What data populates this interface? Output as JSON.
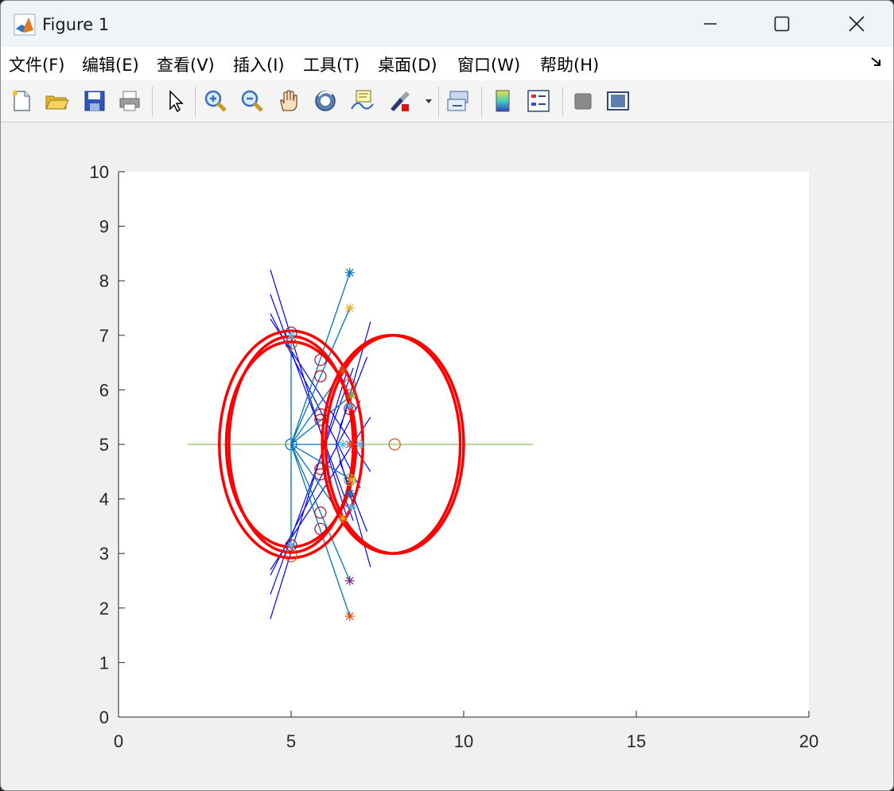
{
  "window": {
    "title": "Figure 1"
  },
  "menu": [
    "文件(F)",
    "编辑(E)",
    "查看(V)",
    "插入(I)",
    "工具(T)",
    "桌面(D)",
    "窗口(W)",
    "帮助(H)"
  ],
  "toolbar": [
    "new-figure-icon",
    "open-file-icon",
    "save-icon",
    "print-icon",
    "select-arrow-icon",
    "zoom-in-icon",
    "zoom-out-icon",
    "pan-hand-icon",
    "rotate-3d-icon",
    "data-tips-icon",
    "brush-icon",
    "brush-dropdown-icon",
    "link-plot-icon",
    "colorbar-icon",
    "legend-icon",
    "hide-plot-tools-icon",
    "show-plot-tools-icon"
  ],
  "chart_data": {
    "type": "scatter",
    "xlim": [
      0,
      20
    ],
    "ylim": [
      0,
      10
    ],
    "x_ticks": [
      "0",
      "5",
      "10",
      "15",
      "20"
    ],
    "y_ticks": [
      "0",
      "1",
      "2",
      "3",
      "4",
      "5",
      "6",
      "7",
      "8",
      "9",
      "10"
    ],
    "grid": false,
    "colors": {
      "circles": "#ff0000",
      "lines": "#0000ff",
      "rays": "#0072bd",
      "axis_line": "#77ac30"
    },
    "horizontal_line": {
      "x": [
        2,
        12
      ],
      "y": 5
    },
    "ellipses": [
      {
        "cx": 5,
        "cy": 5,
        "rx": 2.08,
        "ry": 2.08,
        "color": "#ff0000"
      },
      {
        "cx": 5,
        "cy": 5,
        "rx": 1.88,
        "ry": 1.88,
        "color": "#ff0000"
      },
      {
        "cx": 5,
        "cy": 5,
        "rx": 1.8,
        "ry": 1.98,
        "color": "#ff0000"
      },
      {
        "cx": 8,
        "cy": 5,
        "rx": 2.0,
        "ry": 2.0,
        "color": "#ff0000"
      },
      {
        "cx": 7.9,
        "cy": 5,
        "rx": 2.0,
        "ry": 2.0,
        "color": "#ff0000"
      }
    ],
    "circle_markers": [
      {
        "x": 5,
        "y": 5,
        "color": "#0072bd"
      },
      {
        "x": 8,
        "y": 5,
        "color": "#d95319"
      },
      {
        "x": 5,
        "y": 7.05,
        "color": "#a2142f"
      },
      {
        "x": 5,
        "y": 6.85,
        "color": "#d95319"
      },
      {
        "x": 5.85,
        "y": 6.55,
        "color": "#a2142f"
      },
      {
        "x": 5.85,
        "y": 6.25,
        "color": "#a2142f"
      },
      {
        "x": 5.85,
        "y": 5.55,
        "color": "#a2142f"
      },
      {
        "x": 5.85,
        "y": 5.45,
        "color": "#a2142f"
      },
      {
        "x": 5.85,
        "y": 4.55,
        "color": "#a2142f"
      },
      {
        "x": 5.85,
        "y": 4.45,
        "color": "#a2142f"
      },
      {
        "x": 5.85,
        "y": 3.75,
        "color": "#a2142f"
      },
      {
        "x": 5.85,
        "y": 3.45,
        "color": "#a2142f"
      },
      {
        "x": 5,
        "y": 3.15,
        "color": "#a2142f"
      },
      {
        "x": 5,
        "y": 2.95,
        "color": "#d95319"
      },
      {
        "x": 6.7,
        "y": 6.1,
        "color": "#d95319"
      },
      {
        "x": 6.7,
        "y": 5.65,
        "color": "#a2142f"
      },
      {
        "x": 6.7,
        "y": 4.35,
        "color": "#77ac30"
      },
      {
        "x": 6.7,
        "y": 3.95,
        "color": "#a2142f"
      }
    ],
    "star_markers": [
      {
        "x": 6.7,
        "y": 8.15,
        "color": "#0072bd"
      },
      {
        "x": 6.7,
        "y": 7.5,
        "color": "#edb120"
      },
      {
        "x": 6.5,
        "y": 6.35,
        "color": "#d95319"
      },
      {
        "x": 6.75,
        "y": 5.9,
        "color": "#77ac30"
      },
      {
        "x": 6.7,
        "y": 5.7,
        "color": "#4dbeee"
      },
      {
        "x": 6.7,
        "y": 5.0,
        "color": "#d95319"
      },
      {
        "x": 6.5,
        "y": 5.0,
        "color": "#4dbeee"
      },
      {
        "x": 7.0,
        "y": 5.0,
        "color": "#4dbeee"
      },
      {
        "x": 6.75,
        "y": 4.35,
        "color": "#edb120"
      },
      {
        "x": 6.7,
        "y": 4.1,
        "color": "#0072bd"
      },
      {
        "x": 6.75,
        "y": 3.85,
        "color": "#4dbeee"
      },
      {
        "x": 6.5,
        "y": 3.65,
        "color": "#edb120"
      },
      {
        "x": 6.7,
        "y": 2.5,
        "color": "#7e2f8e"
      },
      {
        "x": 6.7,
        "y": 1.85,
        "color": "#d95319"
      },
      {
        "x": 5,
        "y": 3.15,
        "color": "#4dbeee"
      },
      {
        "x": 5,
        "y": 7.0,
        "color": "#4dbeee"
      }
    ],
    "rays": [
      {
        "x1": 5,
        "y1": 5,
        "x2": 6.7,
        "y2": 8.15
      },
      {
        "x1": 5,
        "y1": 5,
        "x2": 6.7,
        "y2": 7.5
      },
      {
        "x1": 5,
        "y1": 5,
        "x2": 6.5,
        "y2": 6.35
      },
      {
        "x1": 5,
        "y1": 5,
        "x2": 6.75,
        "y2": 5.9
      },
      {
        "x1": 5,
        "y1": 5,
        "x2": 6.7,
        "y2": 5.0
      },
      {
        "x1": 5,
        "y1": 5,
        "x2": 6.75,
        "y2": 4.35
      },
      {
        "x1": 5,
        "y1": 5,
        "x2": 6.5,
        "y2": 3.65
      },
      {
        "x1": 5,
        "y1": 5,
        "x2": 6.7,
        "y2": 2.5
      },
      {
        "x1": 5,
        "y1": 5,
        "x2": 6.7,
        "y2": 1.85
      },
      {
        "x1": 5,
        "y1": 5,
        "x2": 5,
        "y2": 7.0
      },
      {
        "x1": 5,
        "y1": 5,
        "x2": 5,
        "y2": 3.15
      }
    ],
    "blue_lines": [
      {
        "x1": 4.4,
        "y1": 8.2,
        "x2": 6.6,
        "y2": 3.7
      },
      {
        "x1": 4.4,
        "y1": 7.75,
        "x2": 6.8,
        "y2": 3.6
      },
      {
        "x1": 4.4,
        "y1": 7.4,
        "x2": 7.0,
        "y2": 4.2
      },
      {
        "x1": 4.4,
        "y1": 7.3,
        "x2": 7.3,
        "y2": 4.5
      },
      {
        "x1": 4.4,
        "y1": 1.8,
        "x2": 6.6,
        "y2": 6.3
      },
      {
        "x1": 4.4,
        "y1": 2.25,
        "x2": 6.8,
        "y2": 6.4
      },
      {
        "x1": 4.4,
        "y1": 2.6,
        "x2": 7.0,
        "y2": 5.8
      },
      {
        "x1": 4.4,
        "y1": 2.7,
        "x2": 7.3,
        "y2": 5.5
      },
      {
        "x1": 6.3,
        "y1": 5.0,
        "x2": 7.3,
        "y2": 7.25
      },
      {
        "x1": 6.3,
        "y1": 5.0,
        "x2": 7.3,
        "y2": 2.75
      },
      {
        "x1": 6.4,
        "y1": 5.3,
        "x2": 7.2,
        "y2": 6.6
      },
      {
        "x1": 6.4,
        "y1": 4.7,
        "x2": 7.2,
        "y2": 3.4
      }
    ]
  }
}
